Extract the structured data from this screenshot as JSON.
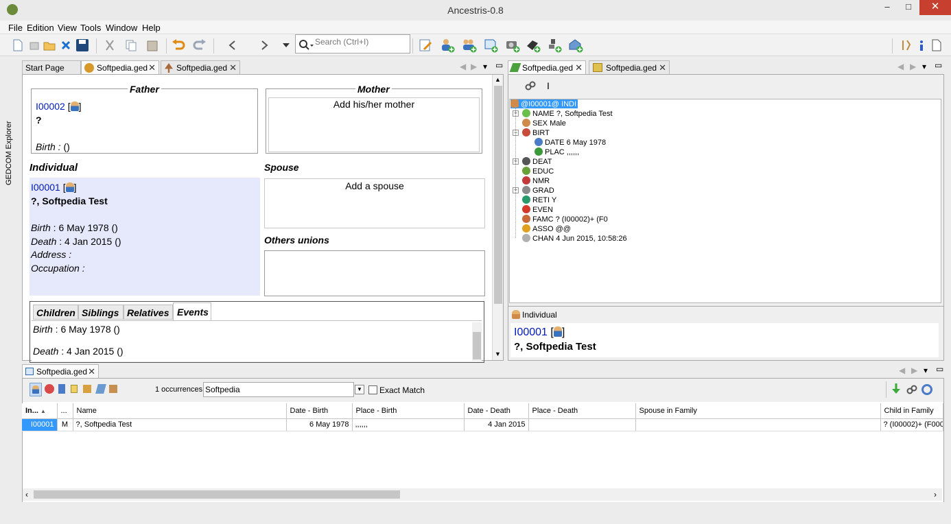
{
  "window": {
    "title": "Ancestris-0.8",
    "minimize": "–",
    "maximize": "□",
    "close": "✕"
  },
  "menu": [
    "File",
    "Edition",
    "View",
    "Tools",
    "Window",
    "Help"
  ],
  "search": {
    "placeholder": "Search (Ctrl+I)"
  },
  "side_explorer": "GEDCOM Explorer",
  "left_tabs": [
    {
      "label": "Start Page"
    },
    {
      "label": "Softpedia.ged"
    },
    {
      "label": "Softpedia.ged"
    }
  ],
  "right_tabs": [
    {
      "label": "Softpedia.ged"
    },
    {
      "label": "Softpedia.ged"
    }
  ],
  "editor": {
    "father": {
      "legend": "Father",
      "id": "I00002",
      "bracket_open": "[",
      "bracket_close": "]",
      "name": "?",
      "birth_label": "Birth :",
      "birth_value": " ()"
    },
    "mother": {
      "legend": "Mother",
      "prompt": "Add his/her mother"
    },
    "individual": {
      "heading": "Individual",
      "id": "I00001",
      "bracket_open": "[",
      "bracket_close": "]",
      "name": "?, Softpedia Test",
      "birth_label": "Birth",
      "birth_value": " : 6 May 1978 ()",
      "death_label": "Death",
      "death_value": " : 4 Jan 2015 ()",
      "address_label": "Address :",
      "occupation_label": "Occupation :"
    },
    "spouse": {
      "heading": "Spouse",
      "prompt": "Add a spouse"
    },
    "others_unions": {
      "heading": "Others unions"
    },
    "subtabs": [
      "Children",
      "Siblings",
      "Relatives",
      "Events"
    ],
    "events": [
      {
        "label": "Birth",
        "value": " : 6 May 1978 ()"
      },
      {
        "label": "Death",
        "value": " : 4 Jan 2015 ()"
      }
    ]
  },
  "tree": {
    "root": "@I00001@ INDI",
    "nodes": [
      {
        "text": "NAME ?, Softpedia Test",
        "icon_color": "#6ac04a",
        "expandable": true,
        "collapsed": true
      },
      {
        "text": "SEX Male",
        "icon_color": "#d08a4a",
        "expandable": false
      },
      {
        "text": "BIRT",
        "icon_color": "#c84c3c",
        "expandable": true,
        "collapsed": false
      },
      {
        "text": "DATE 6 May 1978",
        "icon_color": "#4a7cc8",
        "expandable": false,
        "child": true
      },
      {
        "text": "PLAC ,,,,,,",
        "icon_color": "#3a9a3a",
        "expandable": false,
        "child": true
      },
      {
        "text": "DEAT",
        "icon_color": "#555555",
        "expandable": true,
        "collapsed": true
      },
      {
        "text": "EDUC",
        "icon_color": "#6aa03a",
        "expandable": false
      },
      {
        "text": "NMR",
        "icon_color": "#c43a3a",
        "expandable": false
      },
      {
        "text": "GRAD",
        "icon_color": "#8a8a8a",
        "expandable": true,
        "collapsed": true
      },
      {
        "text": "RETI Y",
        "icon_color": "#2a9a6a",
        "expandable": false
      },
      {
        "text": "EVEN",
        "icon_color": "#d43a2a",
        "expandable": false
      },
      {
        "text": "FAMC ? (I00002)+ (F0",
        "icon_color": "#c86a3a",
        "expandable": false
      },
      {
        "text": "ASSO @@",
        "icon_color": "#e0a020",
        "expandable": false
      },
      {
        "text": "CHAN 4 Jun 2015, 10:58:26",
        "icon_color": "#b0b0b0",
        "expandable": false
      }
    ]
  },
  "individual_panel": {
    "title": "Individual",
    "id": "I00001",
    "bracket_open": "[",
    "bracket_close": "]",
    "name": "?, Softpedia Test"
  },
  "bottom": {
    "tab": "Softpedia.ged",
    "occurrences": "1 occurrences",
    "filter_value": "Softpedia",
    "exact_match": "Exact Match",
    "columns": [
      "In...",
      "...",
      "Name",
      "Date - Birth",
      "Place - Birth",
      "Date - Death",
      "Place - Death",
      "Spouse in Family",
      "Child in Family"
    ],
    "rows": [
      [
        "I00001",
        "M",
        "?, Softpedia Test",
        "6 May 1978",
        ",,,,,,",
        "4 Jan 2015",
        "",
        "",
        "? (I00002)+ (F000"
      ]
    ]
  },
  "colors": {
    "selection": "#3399ff",
    "link_blue": "#0019b8",
    "individual_bg": "#e6e8fb",
    "close_button": "#c7402f"
  }
}
